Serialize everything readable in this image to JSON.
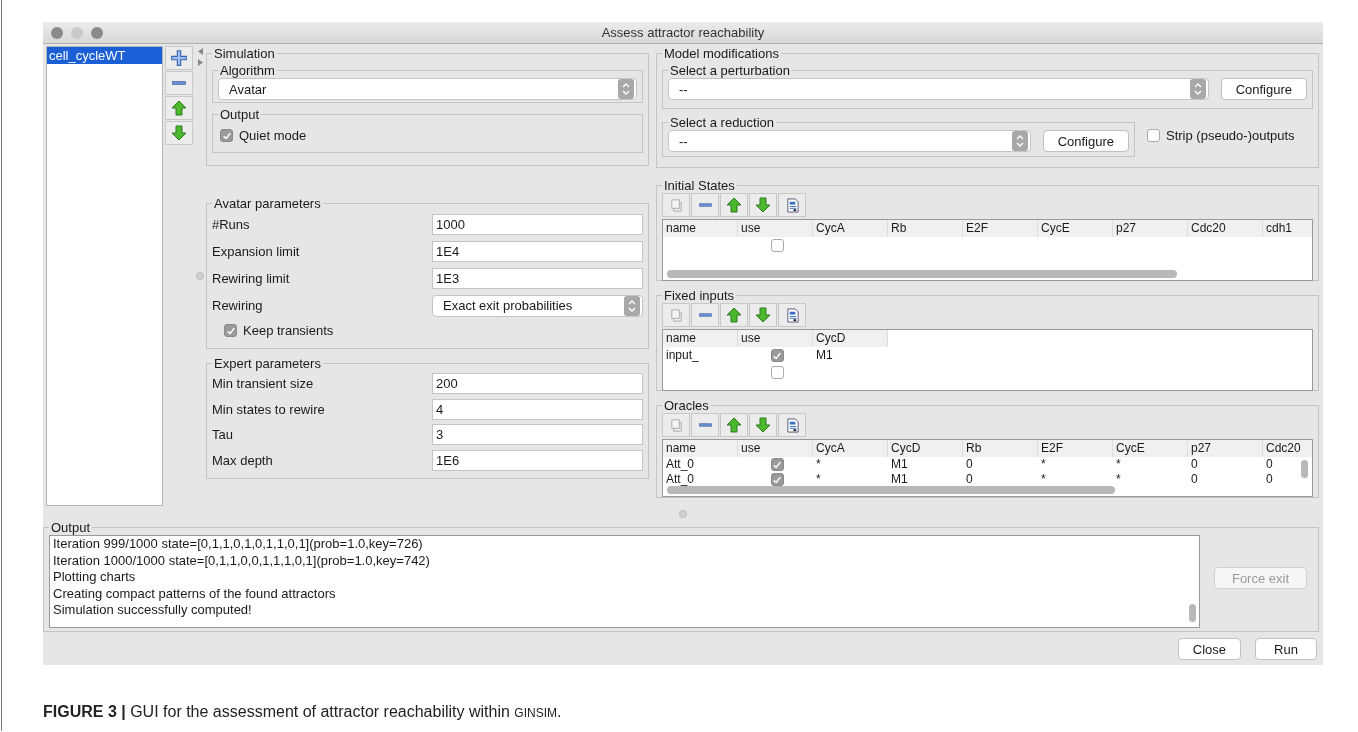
{
  "window": {
    "title": "Assess attractor reachability"
  },
  "models": [
    {
      "label": "cell_cycleWT",
      "selected": true
    }
  ],
  "simulation": {
    "title": "Simulation",
    "algorithm": {
      "title": "Algorithm",
      "value": "Avatar"
    },
    "output": {
      "title": "Output",
      "quiet_mode": {
        "label": "Quiet mode",
        "checked": true
      }
    }
  },
  "avatar_parameters": {
    "title": "Avatar parameters",
    "fields": [
      {
        "label": "#Runs",
        "value": "1000"
      },
      {
        "label": "Expansion limit",
        "value": "1E4"
      },
      {
        "label": "Rewiring limit",
        "value": "1E3"
      }
    ],
    "rewiring": {
      "label": "Rewiring",
      "value": "Exact exit probabilities"
    },
    "keep_transients": {
      "label": "Keep transients",
      "checked": true
    }
  },
  "expert_parameters": {
    "title": "Expert parameters",
    "fields": [
      {
        "label": "Min transient size",
        "value": "200"
      },
      {
        "label": "Min states to rewire",
        "value": "4"
      },
      {
        "label": "Tau",
        "value": "3"
      },
      {
        "label": "Max depth",
        "value": "1E6"
      }
    ]
  },
  "model_modifications": {
    "title": "Model modifications",
    "perturbation": {
      "title": "Select a perturbation",
      "value": "--",
      "button": "Configure"
    },
    "reduction": {
      "title": "Select a reduction",
      "value": "--",
      "button": "Configure"
    },
    "strip_outputs": {
      "label": "Strip (pseudo-)outputs",
      "checked": false
    }
  },
  "tables": [
    {
      "title": "Initial States",
      "columns": [
        "name",
        "use",
        "CycA",
        "Rb",
        "E2F",
        "CycE",
        "p27",
        "Cdc20",
        "cdh1"
      ],
      "rows": [
        {
          "use": false
        }
      ]
    },
    {
      "title": "Fixed inputs",
      "columns": [
        "name",
        "use",
        "CycD"
      ],
      "rows": [
        {
          "use": true,
          "cells": [
            "input_",
            "",
            "M1"
          ]
        },
        {
          "use": false
        }
      ]
    },
    {
      "title": "Oracles",
      "columns": [
        "name",
        "use",
        "CycA",
        "CycD",
        "Rb",
        "E2F",
        "CycE",
        "p27",
        "Cdc20"
      ],
      "rows": [
        {
          "use": true,
          "cells": [
            "Att_0",
            "",
            "*",
            "M1",
            "0",
            "*",
            "*",
            "0",
            "0"
          ]
        },
        {
          "use": true,
          "cells": [
            "Att_0",
            "",
            "*",
            "M1",
            "0",
            "*",
            "*",
            "0",
            "0"
          ]
        }
      ]
    }
  ],
  "output": {
    "title": "Output",
    "lines": [
      "Iteration 999/1000 state=[0,1,1,0,1,0,1,1,0,1](prob=1.0,key=726)",
      "Iteration 1000/1000 state=[0,1,1,0,0,1,1,1,0,1](prob=1.0,key=742)",
      "Plotting charts",
      "Creating compact patterns of the found attractors",
      "Simulation successfully computed!"
    ],
    "force_exit": {
      "label": "Force exit",
      "disabled": true
    }
  },
  "buttons": [
    "Close",
    "Run"
  ],
  "caption": {
    "label": "FIGURE 3 |",
    "text": " GUI for the assessment of attractor reachability within ",
    "small_caps": "GINSIM",
    "end": "."
  }
}
